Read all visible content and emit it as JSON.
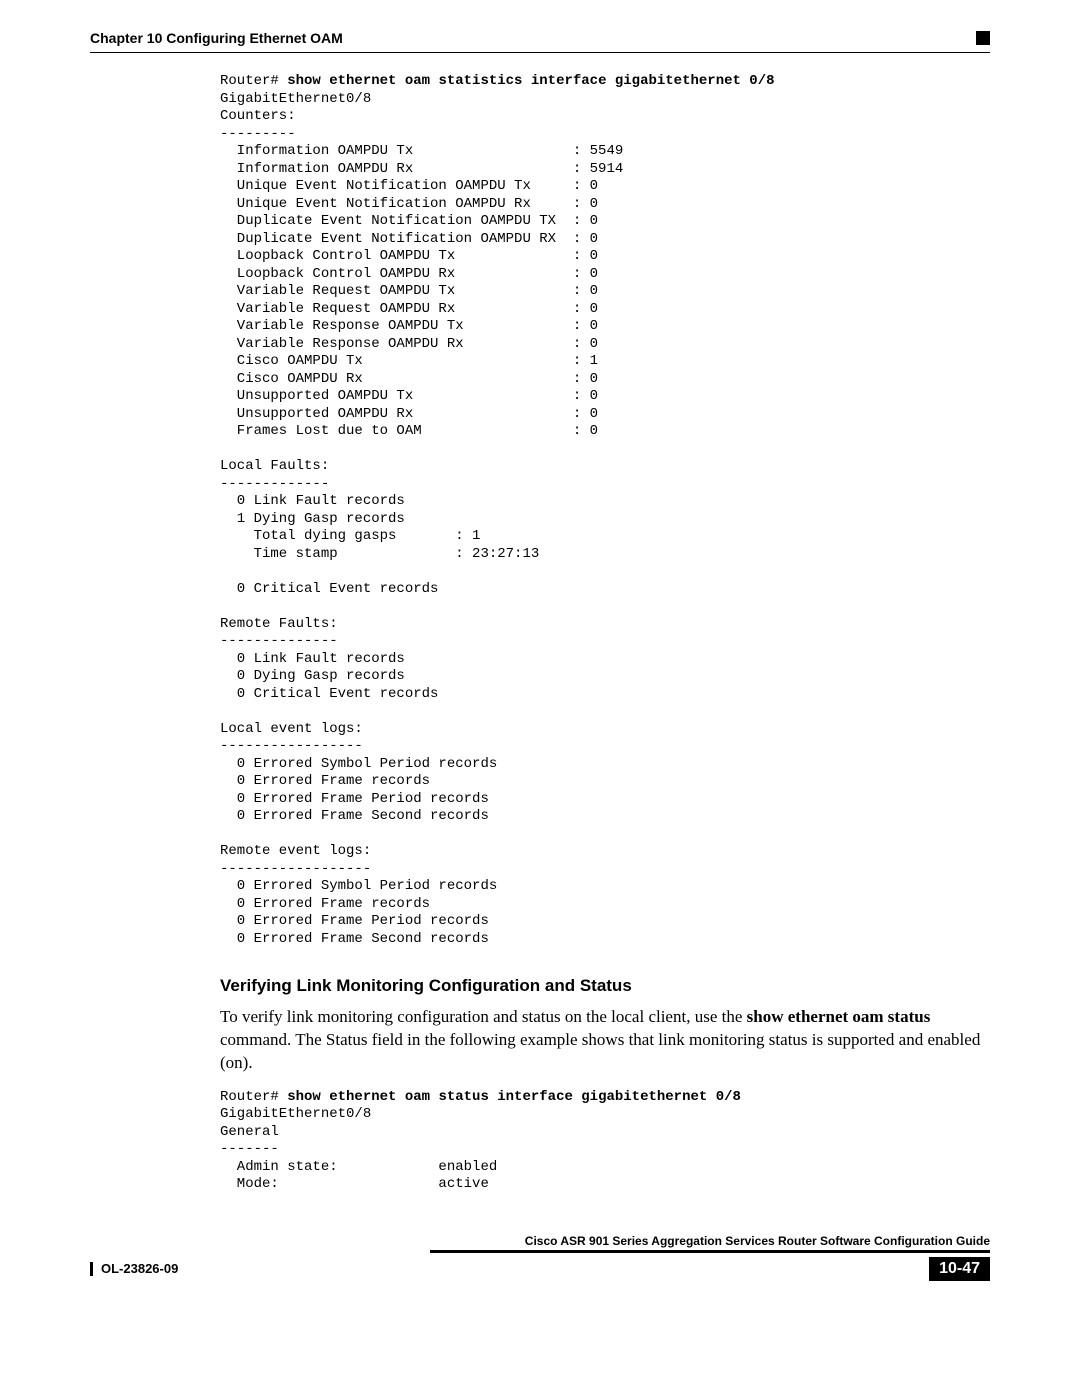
{
  "header": {
    "chapter": "Chapter 10    Configuring Ethernet OAM"
  },
  "cli1": {
    "prompt": "Router# ",
    "command": "show ethernet oam statistics interface gigabitethernet 0/8",
    "output": "GigabitEthernet0/8\nCounters:\n---------\n  Information OAMPDU Tx                   : 5549\n  Information OAMPDU Rx                   : 5914\n  Unique Event Notification OAMPDU Tx     : 0\n  Unique Event Notification OAMPDU Rx     : 0\n  Duplicate Event Notification OAMPDU TX  : 0\n  Duplicate Event Notification OAMPDU RX  : 0\n  Loopback Control OAMPDU Tx              : 0\n  Loopback Control OAMPDU Rx              : 0\n  Variable Request OAMPDU Tx              : 0\n  Variable Request OAMPDU Rx              : 0\n  Variable Response OAMPDU Tx             : 0\n  Variable Response OAMPDU Rx             : 0\n  Cisco OAMPDU Tx                         : 1\n  Cisco OAMPDU Rx                         : 0\n  Unsupported OAMPDU Tx                   : 0\n  Unsupported OAMPDU Rx                   : 0\n  Frames Lost due to OAM                  : 0\n\nLocal Faults:\n-------------\n  0 Link Fault records\n  1 Dying Gasp records\n    Total dying gasps       : 1\n    Time stamp              : 23:27:13\n\n  0 Critical Event records\n\nRemote Faults:\n--------------\n  0 Link Fault records\n  0 Dying Gasp records\n  0 Critical Event records\n\nLocal event logs:\n-----------------\n  0 Errored Symbol Period records\n  0 Errored Frame records\n  0 Errored Frame Period records\n  0 Errored Frame Second records\n\nRemote event logs:\n------------------\n  0 Errored Symbol Period records\n  0 Errored Frame records\n  0 Errored Frame Period records\n  0 Errored Frame Second records"
  },
  "section": {
    "heading": "Verifying Link Monitoring Configuration and Status",
    "para_pre": "To verify link monitoring configuration and status on the local client, use the ",
    "para_cmd": "show ethernet oam status",
    "para_post": " command. The Status field in the following example shows that link monitoring status is supported and enabled (on)."
  },
  "cli2": {
    "prompt": "Router# ",
    "command": "show ethernet oam status interface gigabitethernet 0/8",
    "output": "GigabitEthernet0/8\nGeneral\n-------\n  Admin state:            enabled\n  Mode:                   active"
  },
  "footer": {
    "guide_title": "Cisco ASR 901 Series Aggregation Services Router Software Configuration Guide",
    "doc_id": "OL-23826-09",
    "page_num": "10-47"
  }
}
